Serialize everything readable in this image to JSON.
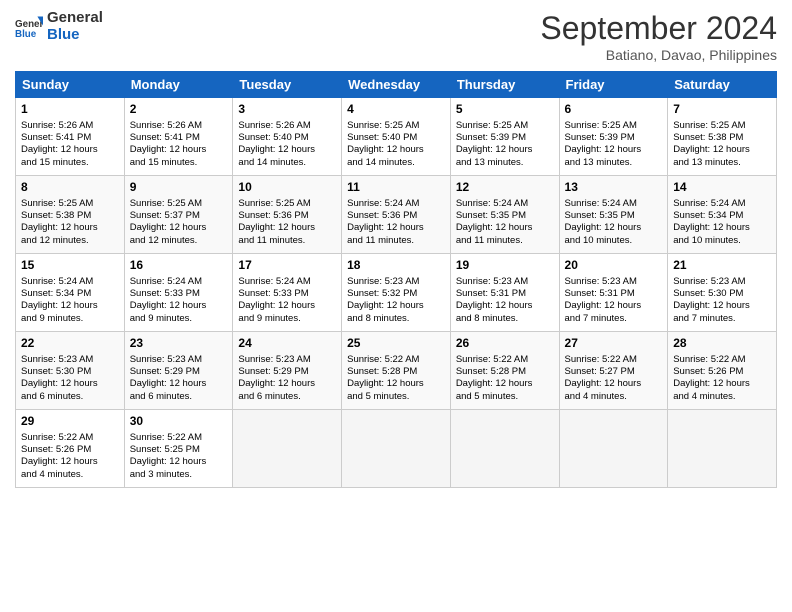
{
  "header": {
    "title": "September 2024",
    "subtitle": "Batiano, Davao, Philippines"
  },
  "calendar": {
    "headers": [
      "Sunday",
      "Monday",
      "Tuesday",
      "Wednesday",
      "Thursday",
      "Friday",
      "Saturday"
    ],
    "weeks": [
      [
        {
          "day": "",
          "content": ""
        },
        {
          "day": "2",
          "content": "Sunrise: 5:26 AM\nSunset: 5:41 PM\nDaylight: 12 hours\nand 15 minutes."
        },
        {
          "day": "3",
          "content": "Sunrise: 5:26 AM\nSunset: 5:40 PM\nDaylight: 12 hours\nand 14 minutes."
        },
        {
          "day": "4",
          "content": "Sunrise: 5:25 AM\nSunset: 5:40 PM\nDaylight: 12 hours\nand 14 minutes."
        },
        {
          "day": "5",
          "content": "Sunrise: 5:25 AM\nSunset: 5:39 PM\nDaylight: 12 hours\nand 13 minutes."
        },
        {
          "day": "6",
          "content": "Sunrise: 5:25 AM\nSunset: 5:39 PM\nDaylight: 12 hours\nand 13 minutes."
        },
        {
          "day": "7",
          "content": "Sunrise: 5:25 AM\nSunset: 5:38 PM\nDaylight: 12 hours\nand 13 minutes."
        }
      ],
      [
        {
          "day": "1",
          "content": "Sunrise: 5:26 AM\nSunset: 5:41 PM\nDaylight: 12 hours\nand 15 minutes."
        },
        {
          "day": "9",
          "content": "Sunrise: 5:25 AM\nSunset: 5:37 PM\nDaylight: 12 hours\nand 12 minutes."
        },
        {
          "day": "10",
          "content": "Sunrise: 5:25 AM\nSunset: 5:36 PM\nDaylight: 12 hours\nand 11 minutes."
        },
        {
          "day": "11",
          "content": "Sunrise: 5:24 AM\nSunset: 5:36 PM\nDaylight: 12 hours\nand 11 minutes."
        },
        {
          "day": "12",
          "content": "Sunrise: 5:24 AM\nSunset: 5:35 PM\nDaylight: 12 hours\nand 11 minutes."
        },
        {
          "day": "13",
          "content": "Sunrise: 5:24 AM\nSunset: 5:35 PM\nDaylight: 12 hours\nand 10 minutes."
        },
        {
          "day": "14",
          "content": "Sunrise: 5:24 AM\nSunset: 5:34 PM\nDaylight: 12 hours\nand 10 minutes."
        }
      ],
      [
        {
          "day": "8",
          "content": "Sunrise: 5:25 AM\nSunset: 5:38 PM\nDaylight: 12 hours\nand 12 minutes."
        },
        {
          "day": "16",
          "content": "Sunrise: 5:24 AM\nSunset: 5:33 PM\nDaylight: 12 hours\nand 9 minutes."
        },
        {
          "day": "17",
          "content": "Sunrise: 5:24 AM\nSunset: 5:33 PM\nDaylight: 12 hours\nand 9 minutes."
        },
        {
          "day": "18",
          "content": "Sunrise: 5:23 AM\nSunset: 5:32 PM\nDaylight: 12 hours\nand 8 minutes."
        },
        {
          "day": "19",
          "content": "Sunrise: 5:23 AM\nSunset: 5:31 PM\nDaylight: 12 hours\nand 8 minutes."
        },
        {
          "day": "20",
          "content": "Sunrise: 5:23 AM\nSunset: 5:31 PM\nDaylight: 12 hours\nand 7 minutes."
        },
        {
          "day": "21",
          "content": "Sunrise: 5:23 AM\nSunset: 5:30 PM\nDaylight: 12 hours\nand 7 minutes."
        }
      ],
      [
        {
          "day": "15",
          "content": "Sunrise: 5:24 AM\nSunset: 5:34 PM\nDaylight: 12 hours\nand 9 minutes."
        },
        {
          "day": "23",
          "content": "Sunrise: 5:23 AM\nSunset: 5:29 PM\nDaylight: 12 hours\nand 6 minutes."
        },
        {
          "day": "24",
          "content": "Sunrise: 5:23 AM\nSunset: 5:29 PM\nDaylight: 12 hours\nand 6 minutes."
        },
        {
          "day": "25",
          "content": "Sunrise: 5:22 AM\nSunset: 5:28 PM\nDaylight: 12 hours\nand 5 minutes."
        },
        {
          "day": "26",
          "content": "Sunrise: 5:22 AM\nSunset: 5:28 PM\nDaylight: 12 hours\nand 5 minutes."
        },
        {
          "day": "27",
          "content": "Sunrise: 5:22 AM\nSunset: 5:27 PM\nDaylight: 12 hours\nand 4 minutes."
        },
        {
          "day": "28",
          "content": "Sunrise: 5:22 AM\nSunset: 5:26 PM\nDaylight: 12 hours\nand 4 minutes."
        }
      ],
      [
        {
          "day": "22",
          "content": "Sunrise: 5:23 AM\nSunset: 5:30 PM\nDaylight: 12 hours\nand 6 minutes."
        },
        {
          "day": "30",
          "content": "Sunrise: 5:22 AM\nSunset: 5:25 PM\nDaylight: 12 hours\nand 3 minutes."
        },
        {
          "day": "",
          "content": ""
        },
        {
          "day": "",
          "content": ""
        },
        {
          "day": "",
          "content": ""
        },
        {
          "day": "",
          "content": ""
        },
        {
          "day": "",
          "content": ""
        }
      ],
      [
        {
          "day": "29",
          "content": "Sunrise: 5:22 AM\nSunset: 5:26 PM\nDaylight: 12 hours\nand 4 minutes."
        },
        {
          "day": "",
          "content": ""
        },
        {
          "day": "",
          "content": ""
        },
        {
          "day": "",
          "content": ""
        },
        {
          "day": "",
          "content": ""
        },
        {
          "day": "",
          "content": ""
        },
        {
          "day": "",
          "content": ""
        }
      ]
    ]
  }
}
